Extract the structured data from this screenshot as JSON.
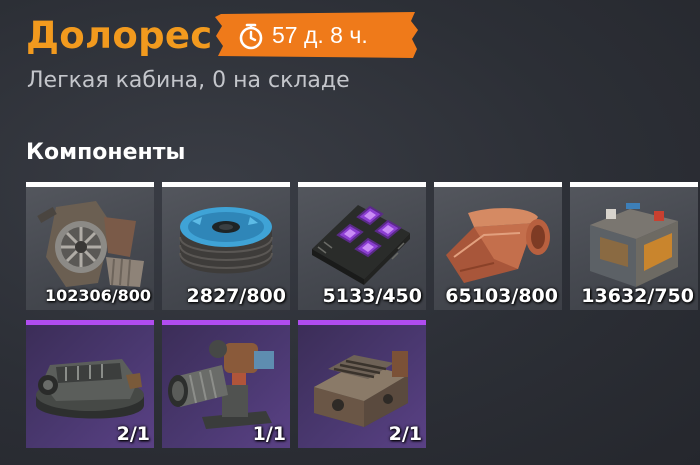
{
  "header": {
    "title": "Долорес",
    "timer": "57 д. 8 ч.",
    "timer_icon": "stopwatch-icon",
    "subtitle": "Легкая кабина, 0 на складе"
  },
  "section": {
    "title": "Компоненты"
  },
  "components_common": [
    {
      "icon": "scrap-metal-icon",
      "count": "102306/800"
    },
    {
      "icon": "wire-spool-icon",
      "count": "2827/800"
    },
    {
      "icon": "electronics-chip-icon",
      "count": "5133/450"
    },
    {
      "icon": "copper-sheet-icon",
      "count": "65103/800"
    },
    {
      "icon": "battery-icon",
      "count": "13632/750"
    }
  ],
  "components_rare": [
    {
      "icon": "engine-part-icon",
      "count": "2/1"
    },
    {
      "icon": "turbine-part-icon",
      "count": "1/1"
    },
    {
      "icon": "engine-block-icon",
      "count": "2/1"
    }
  ],
  "colors": {
    "accent_orange": "#f29a1e",
    "rare_purple": "#b04cf0",
    "common_bar": "#ffffff"
  }
}
